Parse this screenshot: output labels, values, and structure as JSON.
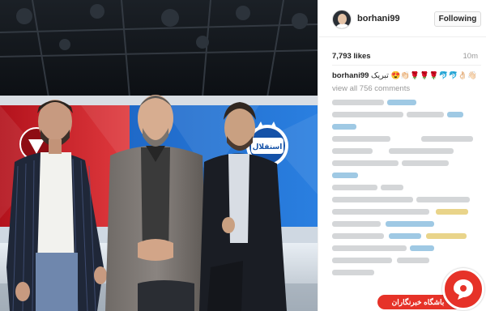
{
  "post": {
    "username": "borhani99",
    "follow_label": "Following",
    "likes": "7,793 likes",
    "time": "10m",
    "caption_user": "borhani99",
    "caption_text": " تبریک 😍👏🏻🌹🌹🌹🐬🐬👌🏻👋🏻",
    "view_all": "view all 756 comments"
  },
  "photo": {
    "banner_text": "استقلال"
  },
  "watermark": {
    "text": "باشگاه خبرنگاران"
  },
  "colors": {
    "brand_red": "#e63228",
    "link_gray": "#999999",
    "esteghlal_blue": "#1a5fb4",
    "persepolis_red": "#c81d25"
  }
}
